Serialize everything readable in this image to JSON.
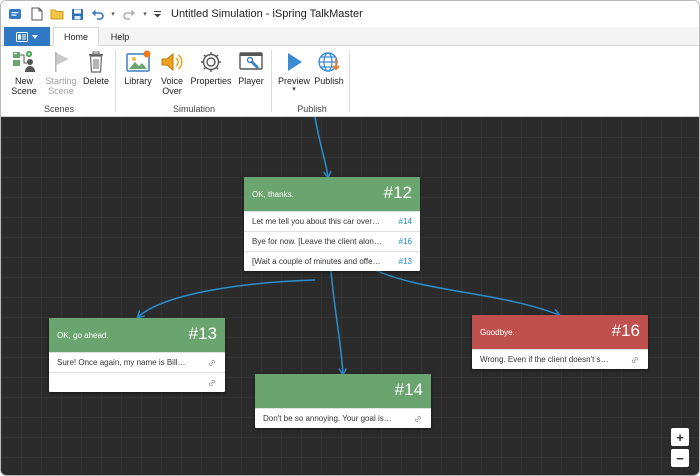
{
  "window": {
    "title": "Untitled Simulation - iSpring TalkMaster"
  },
  "tabs": [
    {
      "label": "Home"
    },
    {
      "label": "Help"
    }
  ],
  "ribbon": {
    "new_scene": "New\nScene",
    "starting_scene": "Starting\nScene",
    "delete": "Delete",
    "library": "Library",
    "voice_over": "Voice\nOver",
    "properties": "Properties",
    "player": "Player",
    "preview": "Preview",
    "publish": "Publish",
    "groups": {
      "scenes": "Scenes",
      "simulation": "Simulation",
      "publish": "Publish"
    }
  },
  "scenes": {
    "s12": {
      "title": "OK, thanks.",
      "number": "#12",
      "color": "#6aa46e",
      "rows": [
        {
          "text": "Let me tell you about this car over here!",
          "ref": "#14"
        },
        {
          "text": "Bye for now. [Leave the client alone an...",
          "ref": "#16"
        },
        {
          "text": "[Wait a couple of minutes and offer th...",
          "ref": "#13"
        }
      ]
    },
    "s13": {
      "title": "OK, go ahead.",
      "number": "#13",
      "color": "#6aa46e",
      "rows": [
        {
          "text": "Sure! Once again, my name is Bill. And ..."
        },
        {
          "text": ""
        }
      ]
    },
    "s14": {
      "title": "",
      "number": "#14",
      "color": "#6aa46e",
      "rows": [
        {
          "text": "Don't be so annoying. Your goal is not t..."
        }
      ]
    },
    "s16": {
      "title": "Goodbye.",
      "number": "#16",
      "color": "#c0504d",
      "rows": [
        {
          "text": "Wrong. Even if the client doesn't seem i..."
        }
      ]
    }
  },
  "zoom": {
    "in": "+",
    "out": "−"
  },
  "colors": {
    "accent": "#2e78c4",
    "connector": "#2a8fd0",
    "canvas": "#2b2b2b"
  }
}
